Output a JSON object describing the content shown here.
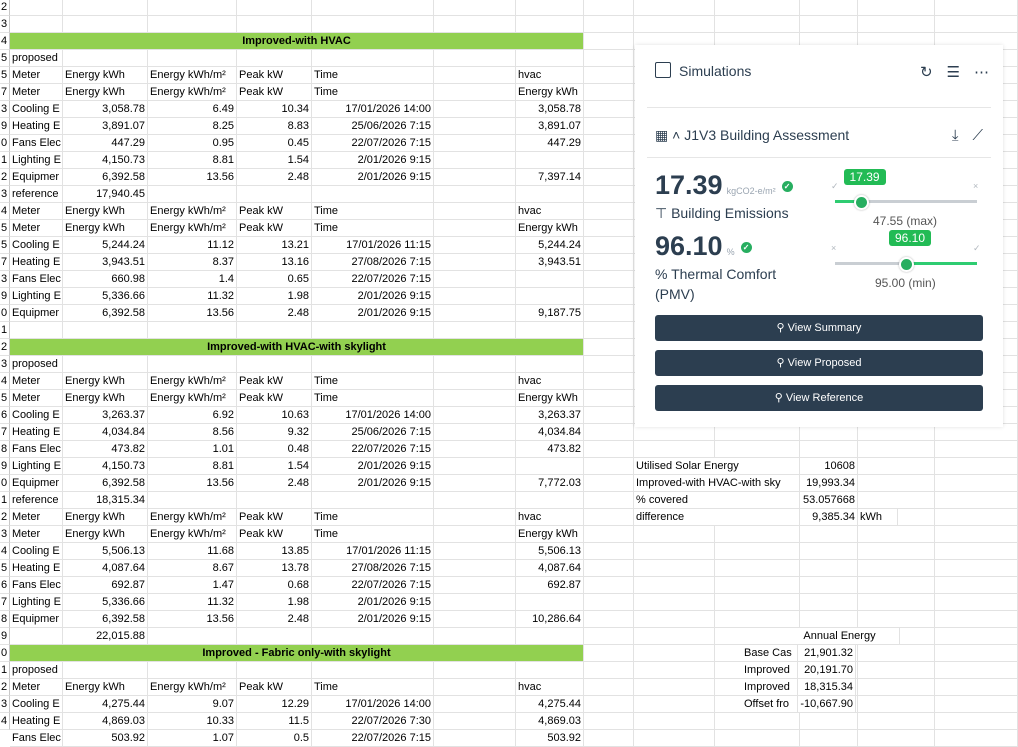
{
  "sheet": {
    "section1": {
      "banner": "Improved-with HVAC",
      "proposed_label": "proposed",
      "header_meter": "Meter",
      "header_energy_kwh": "Energy kWh",
      "header_energy_m2": "Energy kWh/m²",
      "header_peak_kw": "Peak kW",
      "header_time": "Time",
      "header_hvac": "hvac",
      "header_hvac_energy": "Energy kWh",
      "proposed_rows": [
        [
          "Cooling E",
          "3,058.78",
          "6.49",
          "10.34",
          "17/01/2026 14:00",
          "3,058.78"
        ],
        [
          "Heating E",
          "3,891.07",
          "8.25",
          "8.83",
          "25/06/2026 7:15",
          "3,891.07"
        ],
        [
          "Fans Elec",
          "447.29",
          "0.95",
          "0.45",
          "22/07/2026 7:15",
          "447.29"
        ],
        [
          "Lighting E",
          "4,150.73",
          "8.81",
          "1.54",
          "2/01/2026 9:15",
          ""
        ],
        [
          "Equipmer",
          "6,392.58",
          "13.56",
          "2.48",
          "2/01/2026 9:15",
          "7,397.14"
        ]
      ],
      "reference_label": "reference",
      "reference_total": "17,940.45",
      "reference_rows": [
        [
          "Cooling E",
          "5,244.24",
          "11.12",
          "13.21",
          "17/01/2026 11:15",
          "5,244.24"
        ],
        [
          "Heating E",
          "3,943.51",
          "8.37",
          "13.16",
          "27/08/2026 7:15",
          "3,943.51"
        ],
        [
          "Fans Elec",
          "660.98",
          "1.4",
          "0.65",
          "22/07/2026 7:15",
          ""
        ],
        [
          "Lighting E",
          "5,336.66",
          "11.32",
          "1.98",
          "2/01/2026 9:15",
          ""
        ],
        [
          "Equipmer",
          "6,392.58",
          "13.56",
          "2.48",
          "2/01/2026 9:15",
          "9,187.75"
        ]
      ]
    },
    "section2": {
      "banner": "Improved-with HVAC-with skylight",
      "proposed_label": "proposed",
      "proposed_rows": [
        [
          "Cooling E",
          "3,263.37",
          "6.92",
          "10.63",
          "17/01/2026 14:00",
          "3,263.37"
        ],
        [
          "Heating E",
          "4,034.84",
          "8.56",
          "9.32",
          "25/06/2026 7:15",
          "4,034.84"
        ],
        [
          "Fans Elec",
          "473.82",
          "1.01",
          "0.48",
          "22/07/2026 7:15",
          "473.82"
        ],
        [
          "Lighting E",
          "4,150.73",
          "8.81",
          "1.54",
          "2/01/2026 9:15",
          ""
        ],
        [
          "Equipmer",
          "6,392.58",
          "13.56",
          "2.48",
          "2/01/2026 9:15",
          "7,772.03"
        ]
      ],
      "reference_label": "reference",
      "reference_total": "18,315.34",
      "reference_rows": [
        [
          "Cooling E",
          "5,506.13",
          "11.68",
          "13.85",
          "17/01/2026 11:15",
          "5,506.13"
        ],
        [
          "Heating E",
          "4,087.64",
          "8.67",
          "13.78",
          "27/08/2026 7:15",
          "4,087.64"
        ],
        [
          "Fans Elec",
          "692.87",
          "1.47",
          "0.68",
          "22/07/2026 7:15",
          "692.87"
        ],
        [
          "Lighting E",
          "5,336.66",
          "11.32",
          "1.98",
          "2/01/2026 9:15",
          ""
        ],
        [
          "Equipmer",
          "6,392.58",
          "13.56",
          "2.48",
          "2/01/2026 9:15",
          "10,286.64"
        ]
      ],
      "end_total": "22,015.88"
    },
    "section3": {
      "banner": "Improved - Fabric only-with skylight",
      "proposed_label": "proposed",
      "proposed_rows": [
        [
          "Cooling E",
          "4,275.44",
          "9.07",
          "12.29",
          "17/01/2026 14:00",
          "4,275.44"
        ],
        [
          "Heating E",
          "4,869.03",
          "10.33",
          "11.5",
          "22/07/2026 7:30",
          "4,869.03"
        ],
        [
          "Fans Elec",
          "503.92",
          "1.07",
          "0.5",
          "22/07/2026 7:15",
          "503.92"
        ]
      ]
    },
    "row_numbers": [
      "2",
      "3",
      "4",
      "5",
      "5",
      "7",
      "3",
      "9",
      "0",
      "1",
      "2",
      "3",
      "4",
      "5",
      "5",
      "7",
      "3",
      "9",
      "0",
      "1",
      "2",
      "3",
      "4",
      "5",
      "6",
      "7",
      "8",
      "9",
      "0",
      "1",
      "2",
      "3",
      "4",
      "5",
      "6",
      "7",
      "8",
      "9",
      "0",
      "1",
      "2",
      "3",
      "4"
    ],
    "solar": {
      "labels": [
        "Utilised Solar Energy",
        "Improved-with HVAC-with sky",
        "% covered",
        "difference"
      ],
      "values": [
        "10608",
        "19,993.34",
        "53.057668",
        "9,385.34"
      ],
      "unit": "kWh"
    },
    "annual": {
      "title": "Annual Energy",
      "labels": [
        "Base Cas",
        "Improved",
        "Improved",
        "Offset fro"
      ],
      "values": [
        "21,901.32",
        "20,191.70",
        "18,315.34",
        "-10,667.90"
      ]
    }
  },
  "panel": {
    "title": "Simulations",
    "assessment_title": "J1V3 Building Assessment",
    "emissions": {
      "value": "17.39",
      "unit": "kgCO2-e/m²",
      "label": "Building Emissions",
      "slider_value": "17.39",
      "limit": "47.55 (max)",
      "fraction": 0.18
    },
    "comfort": {
      "value": "96.10",
      "unit": "%",
      "label": "Thermal Comfort (PMV)",
      "slider_value": "96.10",
      "limit": "95.00 (min)",
      "fraction": 0.5
    },
    "buttons": [
      "View Summary",
      "View Proposed",
      "View Reference"
    ],
    "colors": {
      "accent_green": "#27ae60",
      "button": "#2c3e50",
      "banner_green": "#92d050"
    }
  }
}
